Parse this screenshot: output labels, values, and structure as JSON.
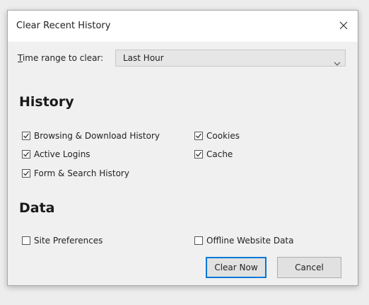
{
  "dialog": {
    "title": "Clear Recent History",
    "close_symbol": "✕"
  },
  "time_range": {
    "label": "Time range to clear:",
    "selected": "Last Hour"
  },
  "history": {
    "heading": "History",
    "options": [
      {
        "label": "Browsing & Download History",
        "checked": true
      },
      {
        "label": "Cookies",
        "checked": true
      },
      {
        "label": "Active Logins",
        "checked": true
      },
      {
        "label": "Cache",
        "checked": true
      },
      {
        "label": "Form & Search History",
        "checked": true
      }
    ]
  },
  "data_section": {
    "heading": "Data",
    "options": [
      {
        "label": "Site Preferences",
        "checked": false
      },
      {
        "label": "Offline Website Data",
        "checked": false
      }
    ]
  },
  "buttons": {
    "clear_now": "Clear Now",
    "cancel": "Cancel"
  },
  "icons": {
    "close": "close-icon",
    "dropdown": "chevron-down-icon",
    "check": "checkmark-icon"
  }
}
